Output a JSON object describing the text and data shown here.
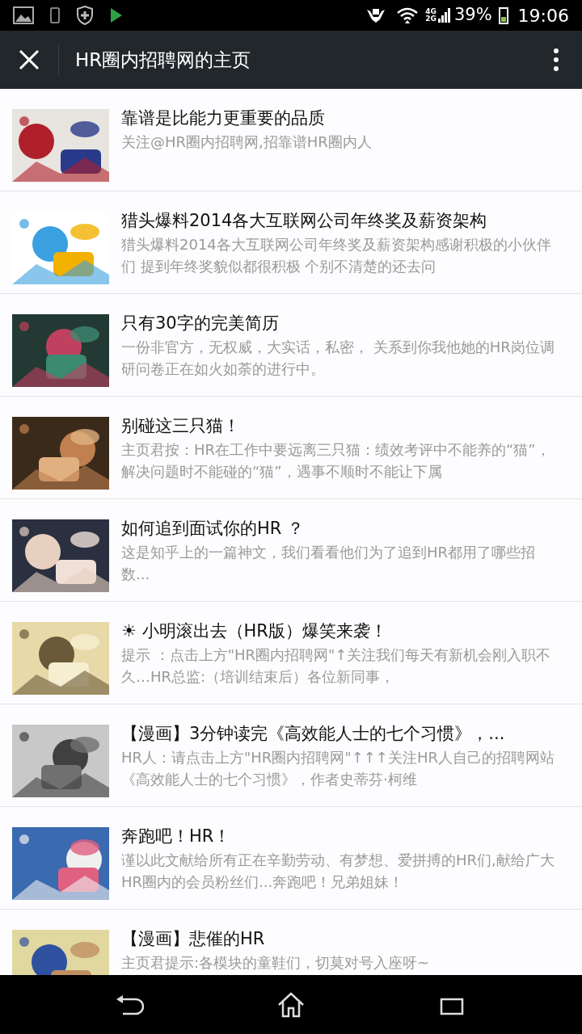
{
  "status_bar": {
    "network_top": "4G",
    "network_bottom": "2G",
    "battery": "39%",
    "time": "19:06"
  },
  "toolbar": {
    "title": "HR圈内招聘网的主页"
  },
  "articles": [
    {
      "title": "靠谱是比能力更重要的品质",
      "summary": "关注@HR圈内招聘网,招靠谱HR圈内人"
    },
    {
      "title": "猎头爆料2014各大互联网公司年终奖及薪资架构",
      "summary": "猎头爆料2014各大互联网公司年终奖及薪资架构感谢积极的小伙伴们 提到年终奖貌似都很积极 个别不清楚的还去问"
    },
    {
      "title": "只有30字的完美简历",
      "summary": "一份非官方，无权威，大实话，私密， 关系到你我他她的HR岗位调研问卷正在如火如荼的进行中。"
    },
    {
      "title": "别碰这三只猫！",
      "summary": "主页君按：HR在工作中要远离三只猫：绩效考评中不能养的“猫”，解决问题时不能碰的“猫”，遇事不顺时不能让下属"
    },
    {
      "title": "如何追到面试你的HR ？",
      "summary": "这是知乎上的一篇神文，我们看看他们为了追到HR都用了哪些招数..."
    },
    {
      "title": "☀ 小明滚出去（HR版）爆笑来袭！",
      "summary": "提示 ：点击上方\"HR圈内招聘网\"↑关注我们每天有新机会刚入职不久…HR总监:（培训结束后）各位新同事，"
    },
    {
      "title": "【漫画】3分钟读完《高效能人士的七个习惯》，...",
      "summary": "HR人：请点击上方\"HR圈内招聘网\"↑↑↑关注HR人自己的招聘网站《高效能人士的七个习惯》，作者史蒂芬·柯维"
    },
    {
      "title": "奔跑吧！HR！",
      "summary": "谨以此文献给所有正在辛勤劳动、有梦想、爱拼搏的HR们,献给广大HR圈内的会员粉丝们...奔跑吧！兄弟姐妹！"
    },
    {
      "title": "【漫画】悲催的HR",
      "summary": "主页君提示:各模块的童鞋们，切莫对号入座呀~"
    }
  ]
}
